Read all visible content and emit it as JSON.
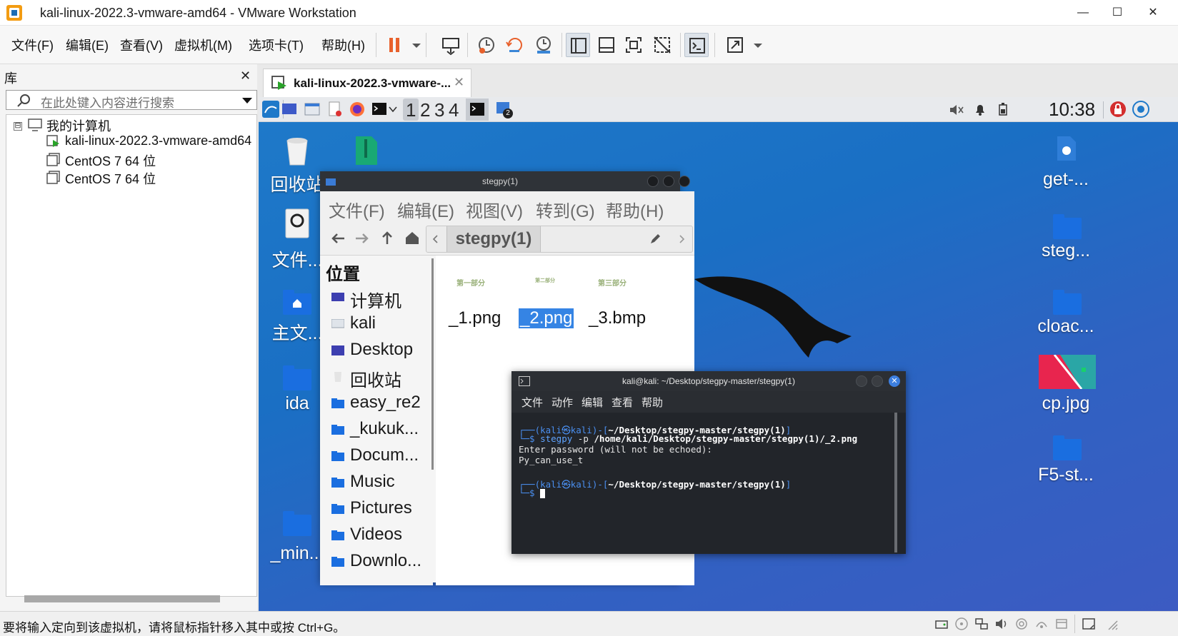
{
  "window": {
    "title": "kali-linux-2022.3-vmware-amd64 - VMware Workstation",
    "minimize_glyph": "—",
    "maximize_glyph": "☐",
    "close_glyph": "✕"
  },
  "menu": {
    "items": [
      "文件(F)",
      "编辑(E)",
      "查看(V)",
      "虚拟机(M)",
      "选项卡(T)",
      "帮助(H)"
    ]
  },
  "toolbar": {
    "icons": [
      "pause-icon",
      "send-ctrl-alt-del-icon",
      "snapshot-icon",
      "revert-snapshot-icon",
      "snapshot-manager-icon",
      "show-library-icon",
      "thumbnail-bar-icon",
      "fullscreen-icon",
      "unity-icon",
      "console-view-icon",
      "stretch-guest-icon"
    ]
  },
  "library": {
    "title": "库",
    "close_glyph": "✕",
    "search_placeholder": "在此处键入内容进行搜索",
    "tree": {
      "root": "我的计算机",
      "expander": "⊟",
      "vms": [
        "kali-linux-2022.3-vmware-amd64",
        "CentOS 7 64 位",
        "CentOS 7 64 位"
      ]
    }
  },
  "vm_tab": {
    "label": "kali-linux-2022.3-vmware-...",
    "close_glyph": "✕"
  },
  "kali_panel": {
    "workspaces": [
      "1",
      "2",
      "3",
      "4"
    ],
    "clock": "10:38",
    "terminal_badge": "2"
  },
  "desktop": {
    "left_icons": [
      "回收站",
      "文件...",
      "主文...",
      "ida",
      "_min..."
    ],
    "right_icons": [
      "get-...",
      "steg...",
      "cloac...",
      "cp.jpg",
      "F5-st..."
    ]
  },
  "file_manager": {
    "title": "stegpy(1)",
    "menu": [
      "文件(F)",
      "编辑(E)",
      "视图(V)",
      "转到(G)",
      "帮助(H)"
    ],
    "path": "stegpy(1)",
    "places_heading": "位置",
    "places": [
      "计算机",
      "kali",
      "Desktop",
      "回收站",
      "easy_re2",
      "_kukuk...",
      "Docum...",
      "Music",
      "Pictures",
      "Videos",
      "Downlo..."
    ],
    "files": [
      {
        "name": "_1.png",
        "thumb": "第一部分"
      },
      {
        "name": "_2.png",
        "thumb": "第二部分"
      },
      {
        "name": "_3.bmp",
        "thumb": "第三部分"
      }
    ],
    "selected_file": "_2.png"
  },
  "terminal": {
    "title": "kali@kali: ~/Desktop/stegpy-master/stegpy(1)",
    "menu": [
      "文件",
      "动作",
      "编辑",
      "查看",
      "帮助"
    ],
    "prompt_user": "kali㉿kali",
    "prompt_path": "~/Desktop/stegpy-master/stegpy(1)",
    "command_bin": "stegpy",
    "command_flag": "-p",
    "command_arg": "/home/kali/Desktop/stegpy-master/stegpy(1)/_2.png",
    "output": [
      "Enter password (will not be echoed):",
      "Py_can_use_t"
    ]
  },
  "statusbar": {
    "message": "要将输入定向到该虚拟机，请将鼠标指针移入其中或按 Ctrl+G。"
  },
  "colors": {
    "accent": "#3584e4",
    "kali_blue": "#1e79c9",
    "pause_orange": "#e8612c"
  }
}
